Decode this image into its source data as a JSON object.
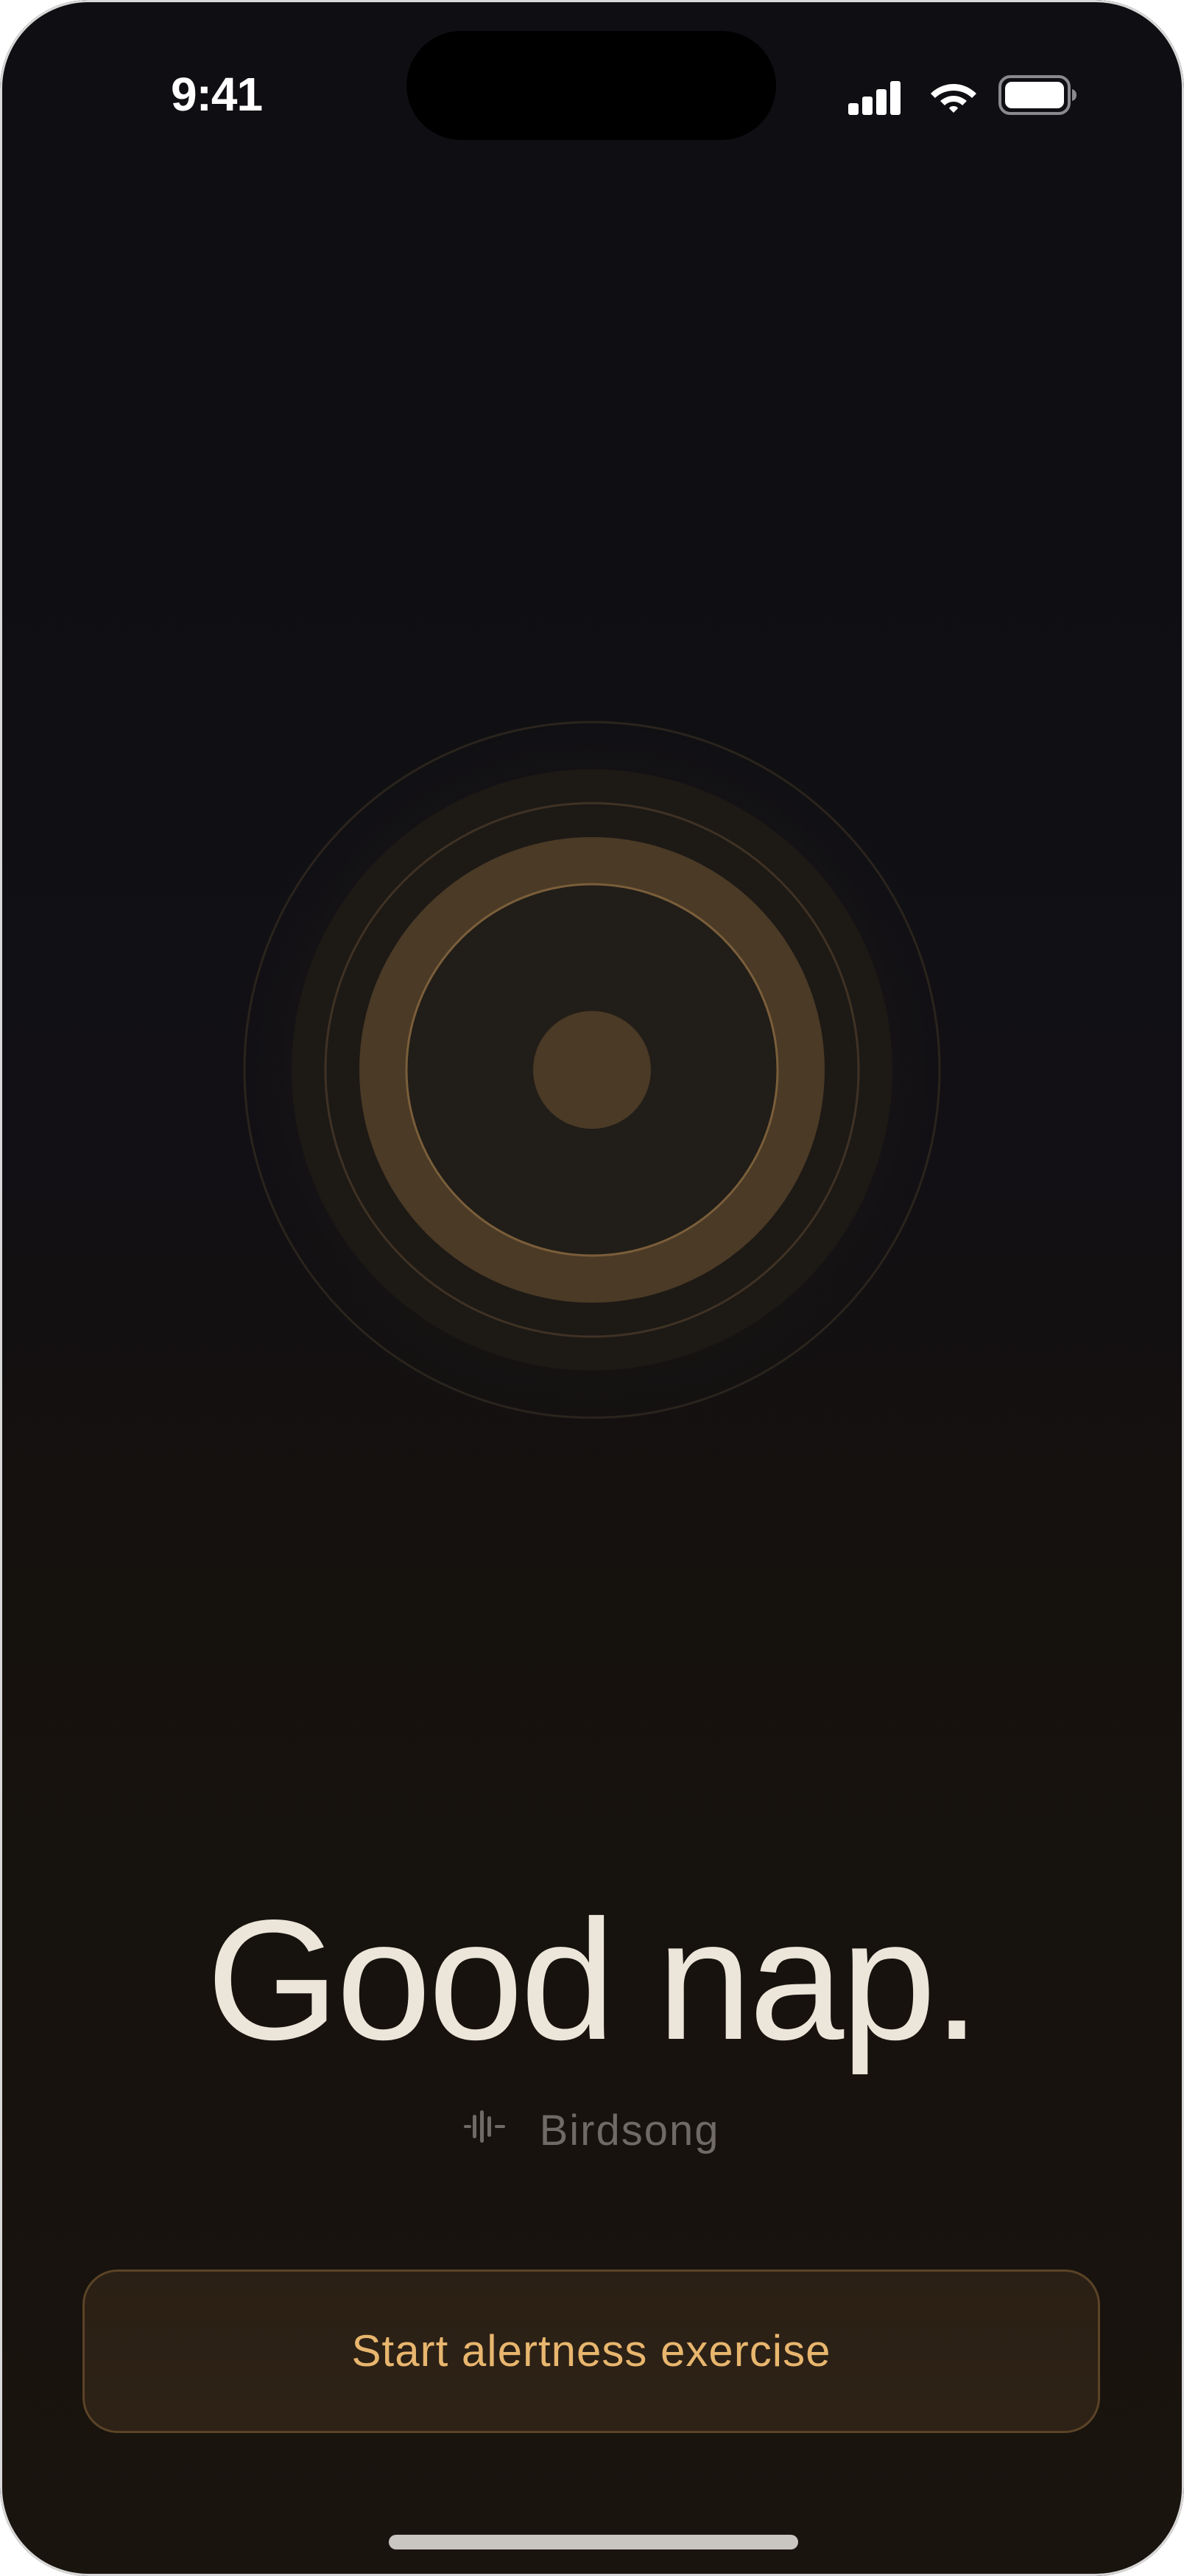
{
  "status_bar": {
    "time": "9:41",
    "icons": [
      "cellular-signal-icon",
      "wifi-icon",
      "battery-icon"
    ]
  },
  "orb": {
    "icon": "pulse-orb-icon"
  },
  "headline": "Good nap.",
  "sound": {
    "icon": "waveform-icon",
    "label": "Birdsong"
  },
  "cta": {
    "label": "Start alertness exercise"
  },
  "colors": {
    "background": "#0f0f13",
    "accent": "#e8b66e",
    "headline": "#ece6da",
    "muted": "#6f6a63",
    "orb_ring": "#4a3a26"
  }
}
